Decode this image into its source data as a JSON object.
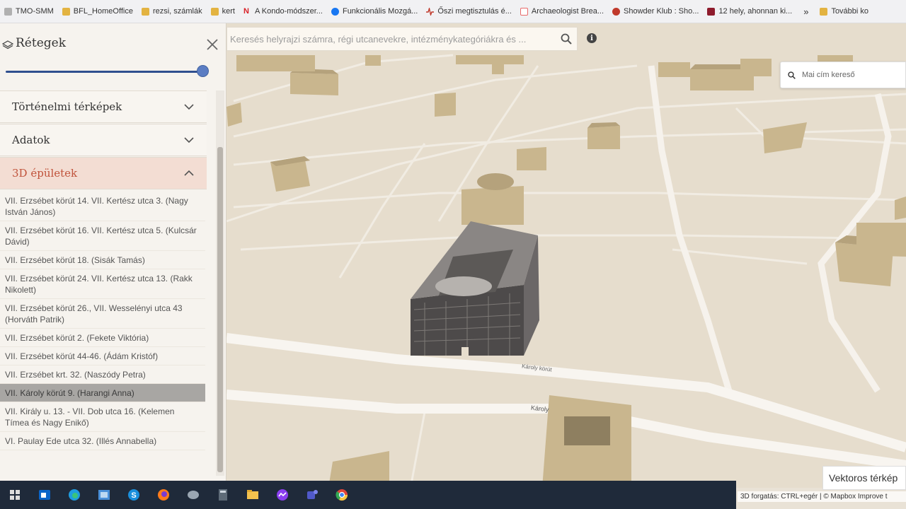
{
  "bookmarks": [
    {
      "label": "TMO-SMM",
      "color": "#b0b0b0"
    },
    {
      "label": "BFL_HomeOffice",
      "color": "#e3b341"
    },
    {
      "label": "rezsi, számlák",
      "color": "#e3b341"
    },
    {
      "label": "kert",
      "color": "#e3b341"
    },
    {
      "label": "A Kondo-módszer...",
      "color": "#d81f26"
    },
    {
      "label": "Funkcionális Mozgá...",
      "color": "#1877f2"
    },
    {
      "label": "Őszi megtisztulás é...",
      "color": "#c0392b"
    },
    {
      "label": "Archaeologist Brea...",
      "color": "#e86a6a"
    },
    {
      "label": "Showder Klub : Sho...",
      "color": "#c0392b"
    },
    {
      "label": "12 hely, ahonnan ki...",
      "color": "#8e1b2c"
    },
    {
      "label": "»",
      "color": ""
    },
    {
      "label": "További ko",
      "color": "#e3b341"
    }
  ],
  "panel": {
    "title": "Rétegek",
    "sections": [
      {
        "label": "Történelmi térképek",
        "expanded": false
      },
      {
        "label": "Adatok",
        "expanded": false
      },
      {
        "label": "3D épületek",
        "expanded": true
      }
    ],
    "items": [
      "VII. Erzsébet körút 14. VII. Kertész utca 3. (Nagy István János)",
      "VII. Erzsébet körút 16. VII. Kertész utca 5. (Kulcsár Dávid)",
      "VII. Erzsébet körút 18. (Sisák Tamás)",
      "VII. Erzsébet körút 24. VII. Kertész utca 13. (Rakk Nikolett)",
      "VII. Erzsébet körút 26., VII. Wesselényi utca 43 (Horváth Patrik)",
      "VII. Erzsébet körút 2. (Fekete Viktória)",
      "VII. Erzsébet körút 44-46. (Ádám Kristóf)",
      "VII. Erzsébet krt. 32. (Naszódy Petra)",
      "VII. Károly körút 9. (Harangi Anna)",
      "VII. Király u. 13. - VII. Dob utca 16. (Kelemen Tímea és Nagy Enikő)",
      "VI. Paulay Ede utca 32. (Illés Annabella)"
    ],
    "selected_index": 8,
    "opacity_slider": 1.0
  },
  "search": {
    "placeholder": "Keresés helyrajzi számra, régi utcanevekre, intézménykategóriákra és ..."
  },
  "address_search": {
    "placeholder": "Mai cím kereső"
  },
  "map": {
    "street_labels": [
      "Károly körút",
      "Károly"
    ],
    "base_layer_label": "Vektoros térkép",
    "attribution": "3D forgatás: CTRL+egér | © Mapbox  Improve t"
  },
  "colors": {
    "accent": "#c0533b",
    "slider": "#2f4f8f",
    "building": "#c9b68e",
    "map_bg": "#e6ddcd"
  },
  "taskbar": [
    "windows-icon",
    "outlook-icon",
    "edge-icon",
    "control-panel-icon",
    "skype-icon",
    "firefox-icon",
    "snipping-tool-icon",
    "calculator-icon",
    "file-explorer-icon",
    "messenger-icon",
    "teams-icon",
    "chrome-icon"
  ]
}
